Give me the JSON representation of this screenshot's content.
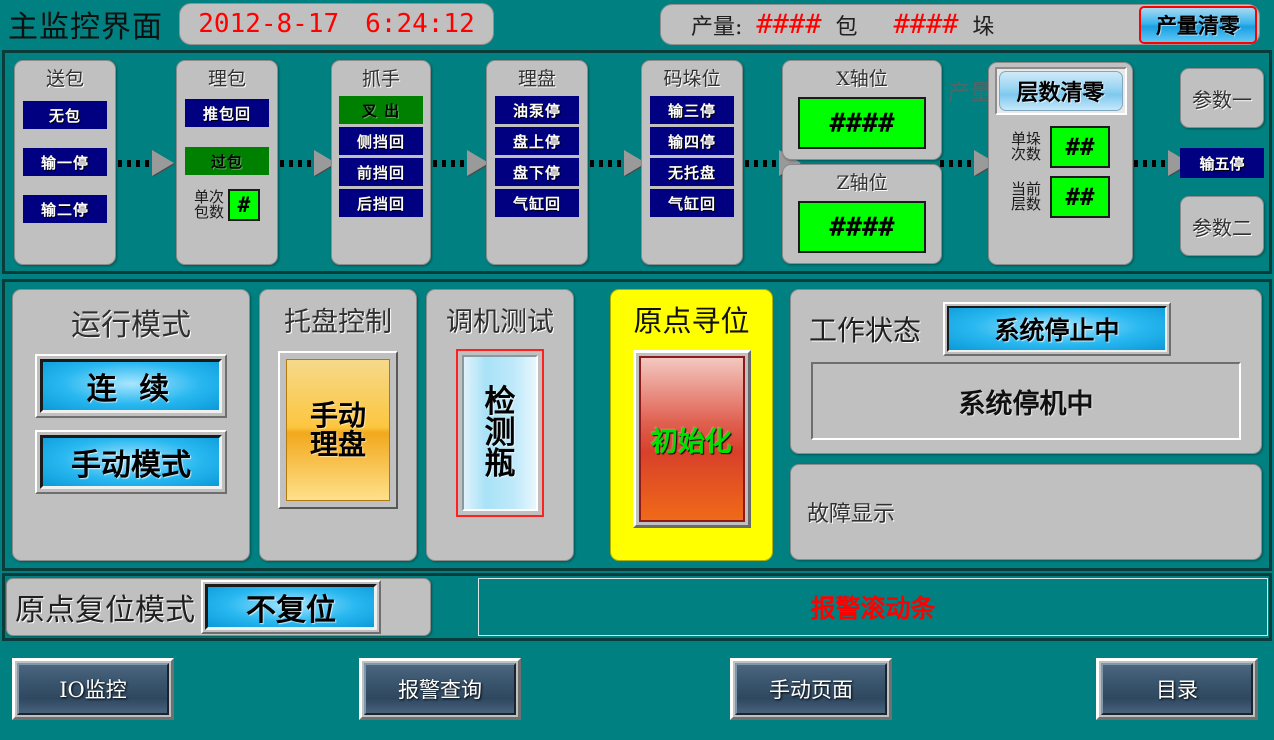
{
  "header": {
    "app_title": "主监控界面",
    "date": "2012-8-17",
    "time": "6:24:12",
    "output_label": "产量:",
    "output_bags_value": "####",
    "output_bags_unit": "包",
    "output_stacks_value": "####",
    "output_stacks_unit": "垛",
    "clear_output_button": "产量清零"
  },
  "ghost_label": "产量",
  "process_panels": [
    {
      "title": "送包",
      "lamps": [
        {
          "label": "无包",
          "state": "blue"
        },
        {
          "label": "输一停",
          "state": "blue"
        },
        {
          "label": "输二停",
          "state": "blue"
        }
      ]
    },
    {
      "title": "理包",
      "lamps": [
        {
          "label": "推包回",
          "state": "blue"
        },
        {
          "label": "过包",
          "state": "green"
        }
      ],
      "counter_label_line1": "单次",
      "counter_label_line2": "包数",
      "counter_value": "#"
    },
    {
      "title": "抓手",
      "lamps": [
        {
          "label": "叉 出",
          "state": "green"
        },
        {
          "label": "侧挡回",
          "state": "blue"
        },
        {
          "label": "前挡回",
          "state": "blue"
        },
        {
          "label": "后挡回",
          "state": "blue"
        }
      ]
    },
    {
      "title": "理盘",
      "lamps": [
        {
          "label": "油泵停",
          "state": "blue"
        },
        {
          "label": "盘上停",
          "state": "blue"
        },
        {
          "label": "盘下停",
          "state": "blue"
        },
        {
          "label": "气缸回",
          "state": "blue"
        }
      ]
    },
    {
      "title": "码垛位",
      "lamps": [
        {
          "label": "输三停",
          "state": "blue"
        },
        {
          "label": "输四停",
          "state": "blue"
        },
        {
          "label": "无托盘",
          "state": "blue"
        },
        {
          "label": "气缸回",
          "state": "blue"
        }
      ]
    }
  ],
  "axis": {
    "x_title": "X轴位",
    "x_value": "####",
    "z_title": "Z轴位",
    "z_value": "####"
  },
  "layer": {
    "clear_button": "层数清零",
    "single_stack_label_line1": "单垛",
    "single_stack_label_line2": "次数",
    "single_stack_value": "##",
    "current_layer_label_line1": "当前",
    "current_layer_label_line2": "层数",
    "current_layer_value": "##"
  },
  "right_column": {
    "param_one": "参数一",
    "conveyor_lamp": "输五停",
    "param_two": "参数二"
  },
  "run_mode": {
    "title": "运行模式",
    "button_continuous": "连 续",
    "button_manual": "手动模式"
  },
  "tray_control": {
    "title": "托盘控制",
    "button_line1": "手动",
    "button_line2": "理盘"
  },
  "machine_test": {
    "title": "调机测试",
    "button_chars": [
      "检",
      "测",
      "瓶"
    ]
  },
  "homing": {
    "title": "原点寻位",
    "button": "初始化"
  },
  "work_status": {
    "title": "工作状态",
    "badge": "系统停止中",
    "message": "系统停机中",
    "fault_label": "故障显示",
    "fault_value": ""
  },
  "home_reset": {
    "label": "原点复位模式",
    "button": "不复位"
  },
  "alarm": {
    "scroll_text": "报警滚动条"
  },
  "nav": {
    "io_monitor": "IO监控",
    "alarm_query": "报警查询",
    "manual_page": "手动页面",
    "menu": "目录"
  },
  "colors": {
    "background": "#008080",
    "panel": "#c0c0c0",
    "lamp_off": "#000080",
    "lamp_on": "#008000",
    "display": "#00ff00",
    "accent_red": "#ff0000",
    "highlight_yellow": "#ffff00"
  }
}
